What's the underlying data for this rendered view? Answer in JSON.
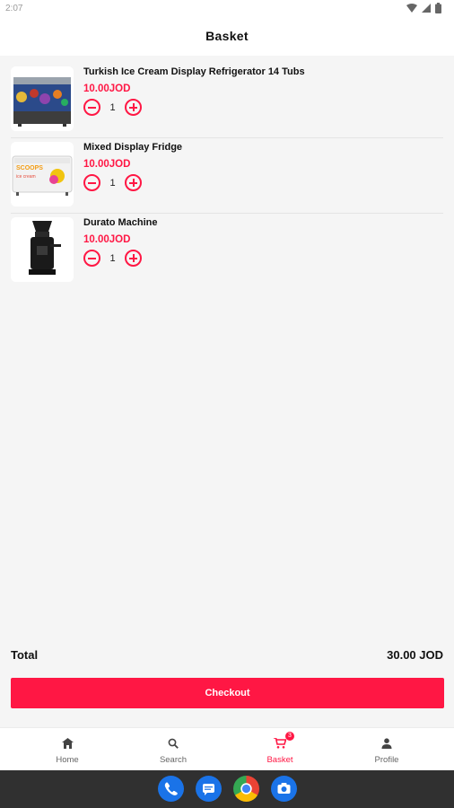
{
  "status": {
    "time": "2:07"
  },
  "header": {
    "title": "Basket"
  },
  "items": [
    {
      "name": "Turkish Ice Cream Display Refrigerator 14 Tubs",
      "price": "10.00JOD",
      "qty": "1"
    },
    {
      "name": "Mixed Display Fridge",
      "price": "10.00JOD",
      "qty": "1"
    },
    {
      "name": "Durato Machine",
      "price": "10.00JOD",
      "qty": "1"
    }
  ],
  "summary": {
    "total_label": "Total",
    "total_value": "30.00 JOD",
    "checkout_label": "Checkout"
  },
  "nav": {
    "home": "Home",
    "search": "Search",
    "basket": "Basket",
    "basket_badge": "3",
    "profile": "Profile"
  },
  "colors": {
    "accent": "#ff1744",
    "background": "#f5f5f5"
  },
  "icons": [
    "wifi-icon",
    "signal-icon",
    "battery-icon",
    "minus-icon",
    "plus-icon",
    "home-icon",
    "search-icon",
    "cart-icon",
    "person-icon",
    "phone-icon",
    "messages-icon",
    "chrome-icon",
    "camera-icon"
  ]
}
